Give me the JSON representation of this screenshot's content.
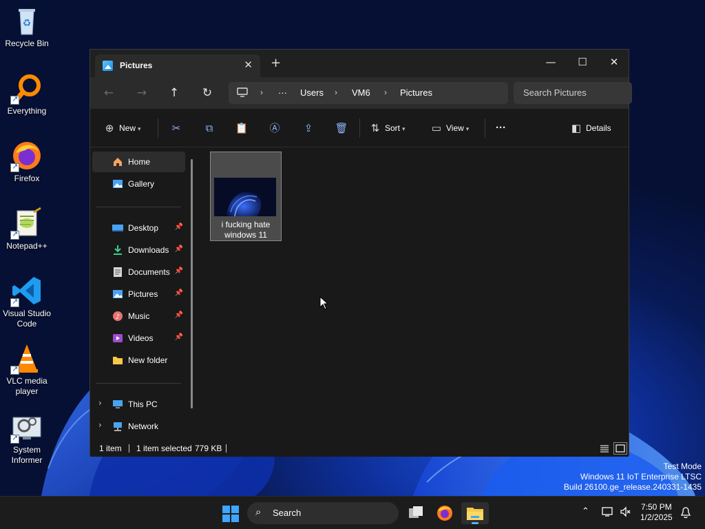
{
  "desktop": {
    "icons": [
      {
        "label": "Recycle Bin",
        "icon": "recycle-bin-icon"
      },
      {
        "label": "Everything",
        "icon": "everything-icon"
      },
      {
        "label": "Firefox",
        "icon": "firefox-icon"
      },
      {
        "label": "Notepad++",
        "icon": "notepadpp-icon"
      },
      {
        "label": "Visual Studio Code",
        "icon": "vscode-icon"
      },
      {
        "label": "VLC media player",
        "icon": "vlc-icon"
      },
      {
        "label": "System Informer",
        "icon": "system-informer-icon"
      }
    ],
    "watermark": {
      "line1": "Test Mode",
      "line2": "Windows 11 IoT Enterprise LTSC",
      "line3": "Build 26100.ge_release.240331-1435"
    }
  },
  "window": {
    "tab_title": "Pictures",
    "new_tab": "+",
    "controls": {
      "minimize": "—",
      "maximize": "☐",
      "close": "✕"
    },
    "breadcrumb": [
      "Users",
      "VM6",
      "Pictures"
    ],
    "breadcrumb_more": "···",
    "search_placeholder": "Search Pictures",
    "toolbar": {
      "new_label": "New",
      "sort_label": "Sort",
      "view_label": "View",
      "more_label": "···",
      "details_label": "Details"
    },
    "sidebar": {
      "top": [
        {
          "label": "Home",
          "selected": true
        },
        {
          "label": "Gallery"
        }
      ],
      "pinned": [
        {
          "label": "Desktop",
          "pinned": true
        },
        {
          "label": "Downloads",
          "pinned": true
        },
        {
          "label": "Documents",
          "pinned": true
        },
        {
          "label": "Pictures",
          "pinned": true
        },
        {
          "label": "Music",
          "pinned": true
        },
        {
          "label": "Videos",
          "pinned": true
        },
        {
          "label": "New folder"
        }
      ],
      "bottom": [
        {
          "label": "This PC"
        },
        {
          "label": "Network"
        }
      ]
    },
    "files": [
      {
        "name": "i fucking hate windows 11",
        "line1": "i fucking hate",
        "line2": "windows 11",
        "selected": true
      }
    ],
    "status": {
      "count": "1 item",
      "selected": "1 item selected",
      "size": "779 KB"
    }
  },
  "taskbar": {
    "search_label": "Search",
    "time": "7:50 PM",
    "date": "1/2/2025"
  },
  "colors": {
    "accent": "#8ab4f8",
    "window_bg": "#191919",
    "titlebar_bg": "#202020",
    "taskbar_bg": "#1c1c1c"
  }
}
